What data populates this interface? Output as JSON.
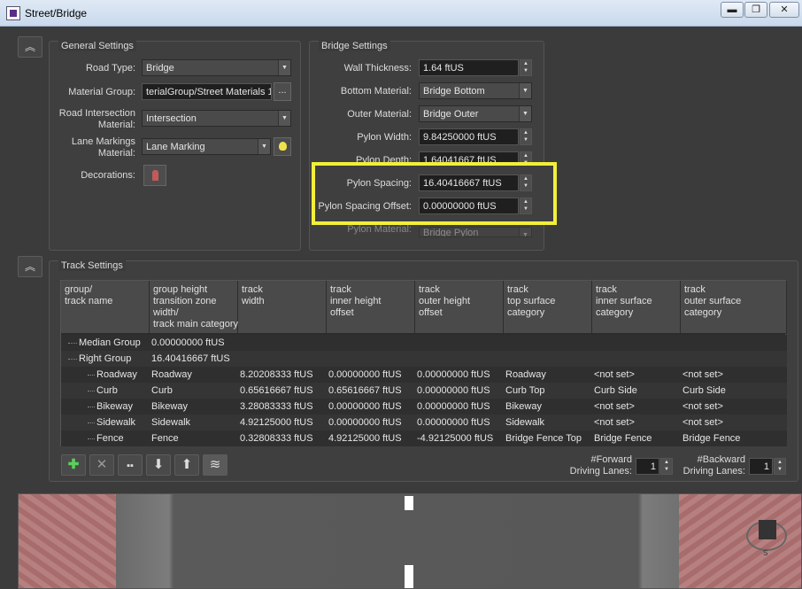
{
  "window": {
    "title": "Street/Bridge",
    "min": "▬",
    "max": "❐",
    "close": "✕"
  },
  "general": {
    "title": "General Settings",
    "road_type_label": "Road Type:",
    "road_type": "Bridge",
    "material_group_label": "Material Group:",
    "material_group": "terialGroup/Street Materials 1",
    "browse": "...",
    "intersection_label": "Road Intersection Material:",
    "intersection": "Intersection",
    "lane_label": "Lane Markings Material:",
    "lane": "Lane Marking",
    "decorations_label": "Decorations:"
  },
  "bridge": {
    "title": "Bridge Settings",
    "wall_label": "Wall Thickness:",
    "wall": "1.64 ftUS",
    "bottom_label": "Bottom Material:",
    "bottom": "Bridge Bottom",
    "outer_label": "Outer Material:",
    "outer": "Bridge Outer",
    "pw_label": "Pylon Width:",
    "pw": "9.84250000 ftUS",
    "pd_label": "Pylon Depth:",
    "pd": "1.64041667 ftUS",
    "ps_label": "Pylon Spacing:",
    "ps": "16.40416667 ftUS",
    "pso_label": "Pylon Spacing Offset:",
    "pso": "0.00000000 ftUS",
    "pm_label": "Pylon Material:",
    "pm": "Bridge Pylon"
  },
  "highlight_color": "#f2ef3a",
  "track": {
    "title": "Track Settings",
    "headers": [
      "group/\ntrack name",
      "group height\ntransition zone\nwidth/\ntrack main category",
      "track\nwidth",
      "track\ninner height\noffset",
      "track\nouter height\noffset",
      "track\ntop surface\ncategory",
      "track\ninner surface\ncategory",
      "track\nouter surface\ncategory"
    ],
    "rows": [
      {
        "name": "Median Group",
        "cols": [
          "0.00000000 ftUS",
          "",
          "",
          "",
          "",
          "",
          ""
        ]
      },
      {
        "name": "Right Group",
        "cols": [
          "16.40416667 ftUS",
          "",
          "",
          "",
          "",
          "",
          ""
        ]
      },
      {
        "name": "Roadway",
        "cols": [
          "Roadway",
          "8.20208333 ftUS",
          "0.00000000 ftUS",
          "0.00000000 ftUS",
          "Roadway",
          "<not set>",
          "<not set>"
        ]
      },
      {
        "name": "Curb",
        "cols": [
          "Curb",
          "0.65616667 ftUS",
          "0.65616667 ftUS",
          "0.00000000 ftUS",
          "Curb Top",
          "Curb Side",
          "Curb Side"
        ]
      },
      {
        "name": "Bikeway",
        "cols": [
          "Bikeway",
          "3.28083333 ftUS",
          "0.00000000 ftUS",
          "0.00000000 ftUS",
          "Bikeway",
          "<not set>",
          "<not set>"
        ]
      },
      {
        "name": "Sidewalk",
        "cols": [
          "Sidewalk",
          "4.92125000 ftUS",
          "0.00000000 ftUS",
          "0.00000000 ftUS",
          "Sidewalk",
          "<not set>",
          "<not set>"
        ]
      },
      {
        "name": "Fence",
        "cols": [
          "Fence",
          "0.32808333 ftUS",
          "4.92125000 ftUS",
          "-4.92125000 ftUS",
          "Bridge Fence Top",
          "Bridge Fence",
          "Bridge Fence"
        ]
      }
    ],
    "forward_label": "#Forward\nDriving Lanes:",
    "forward": "1",
    "backward_label": "#Backward\nDriving Lanes:",
    "backward": "1"
  },
  "compass": {
    "n": "N",
    "s": "S"
  }
}
